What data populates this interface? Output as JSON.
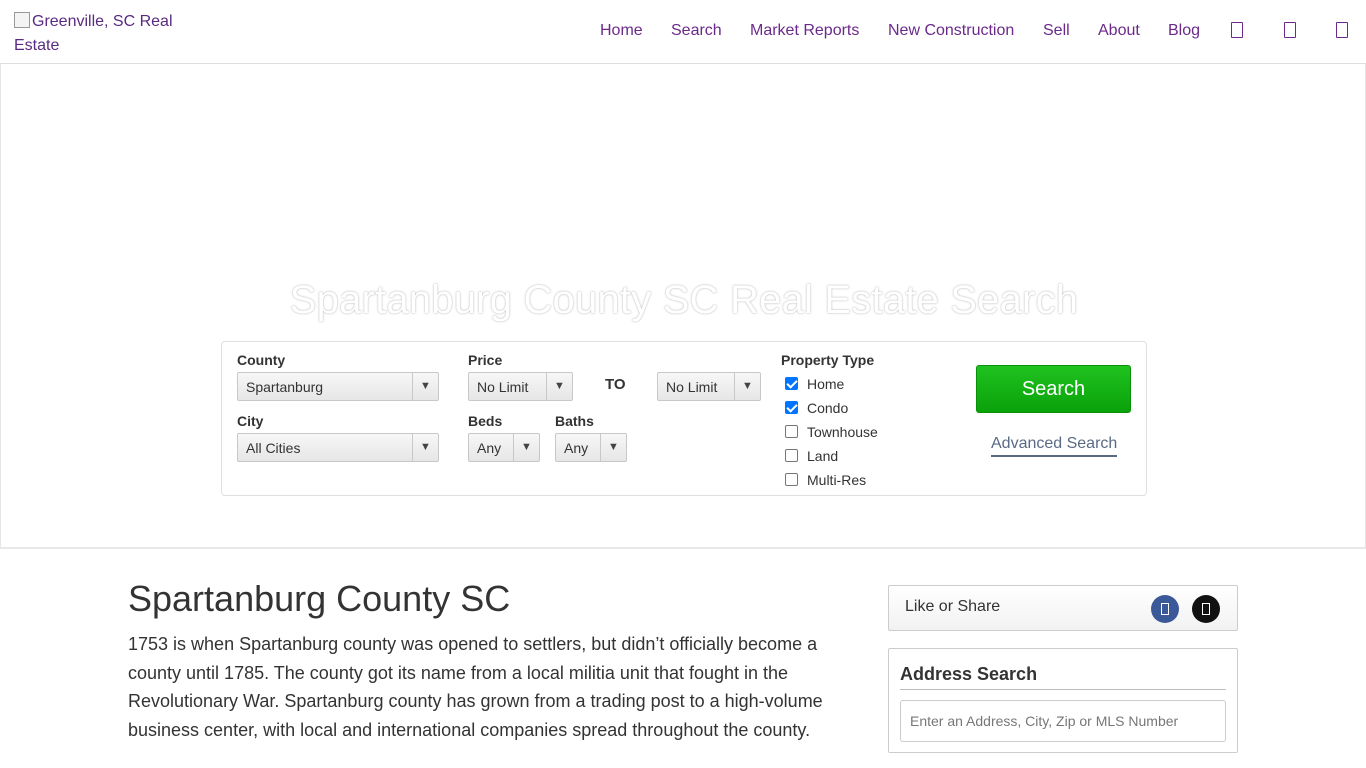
{
  "header": {
    "logo_alt": "Greenville, SC Real Estate",
    "nav": [
      {
        "label": "Home"
      },
      {
        "label": "Search"
      },
      {
        "label": "Market Reports"
      },
      {
        "label": "New Construction"
      },
      {
        "label": "Sell"
      },
      {
        "label": "About"
      },
      {
        "label": "Blog"
      }
    ],
    "icons": [
      "icon-1",
      "icon-2",
      "icon-3"
    ],
    "nav_color": "#6b2a8a"
  },
  "hero": {
    "title": "Spartanburg County SC Real Estate Search",
    "search": {
      "county_label": "County",
      "county_value": "Spartanburg",
      "city_label": "City",
      "city_value": "All Cities",
      "price_label": "Price",
      "price_min": "No Limit",
      "to_label": "TO",
      "price_max": "No Limit",
      "beds_label": "Beds",
      "beds_value": "Any",
      "baths_label": "Baths",
      "baths_value": "Any",
      "property_type_label": "Property Type",
      "property_types": [
        {
          "label": "Home",
          "checked": true
        },
        {
          "label": "Condo",
          "checked": true
        },
        {
          "label": "Townhouse",
          "checked": false
        },
        {
          "label": "Land",
          "checked": false
        },
        {
          "label": "Multi-Res",
          "checked": false
        }
      ],
      "search_button": "Search",
      "advanced_link": "Advanced Search",
      "button_color": "#13b313"
    }
  },
  "main": {
    "title": "Spartanburg County SC",
    "intro": "1753 is when Spartanburg county was opened to settlers, but didn’t officially become a county until 1785. The county got its name from a local militia unit that fought in the Revolutionary War. Spartanburg county has grown from a trading post to a high-volume business center, with local and international companies spread throughout the county."
  },
  "sidebar": {
    "share_label": "Like or Share",
    "address_search_title": "Address Search",
    "address_placeholder": "Enter an Address, City, Zip or MLS Number"
  }
}
